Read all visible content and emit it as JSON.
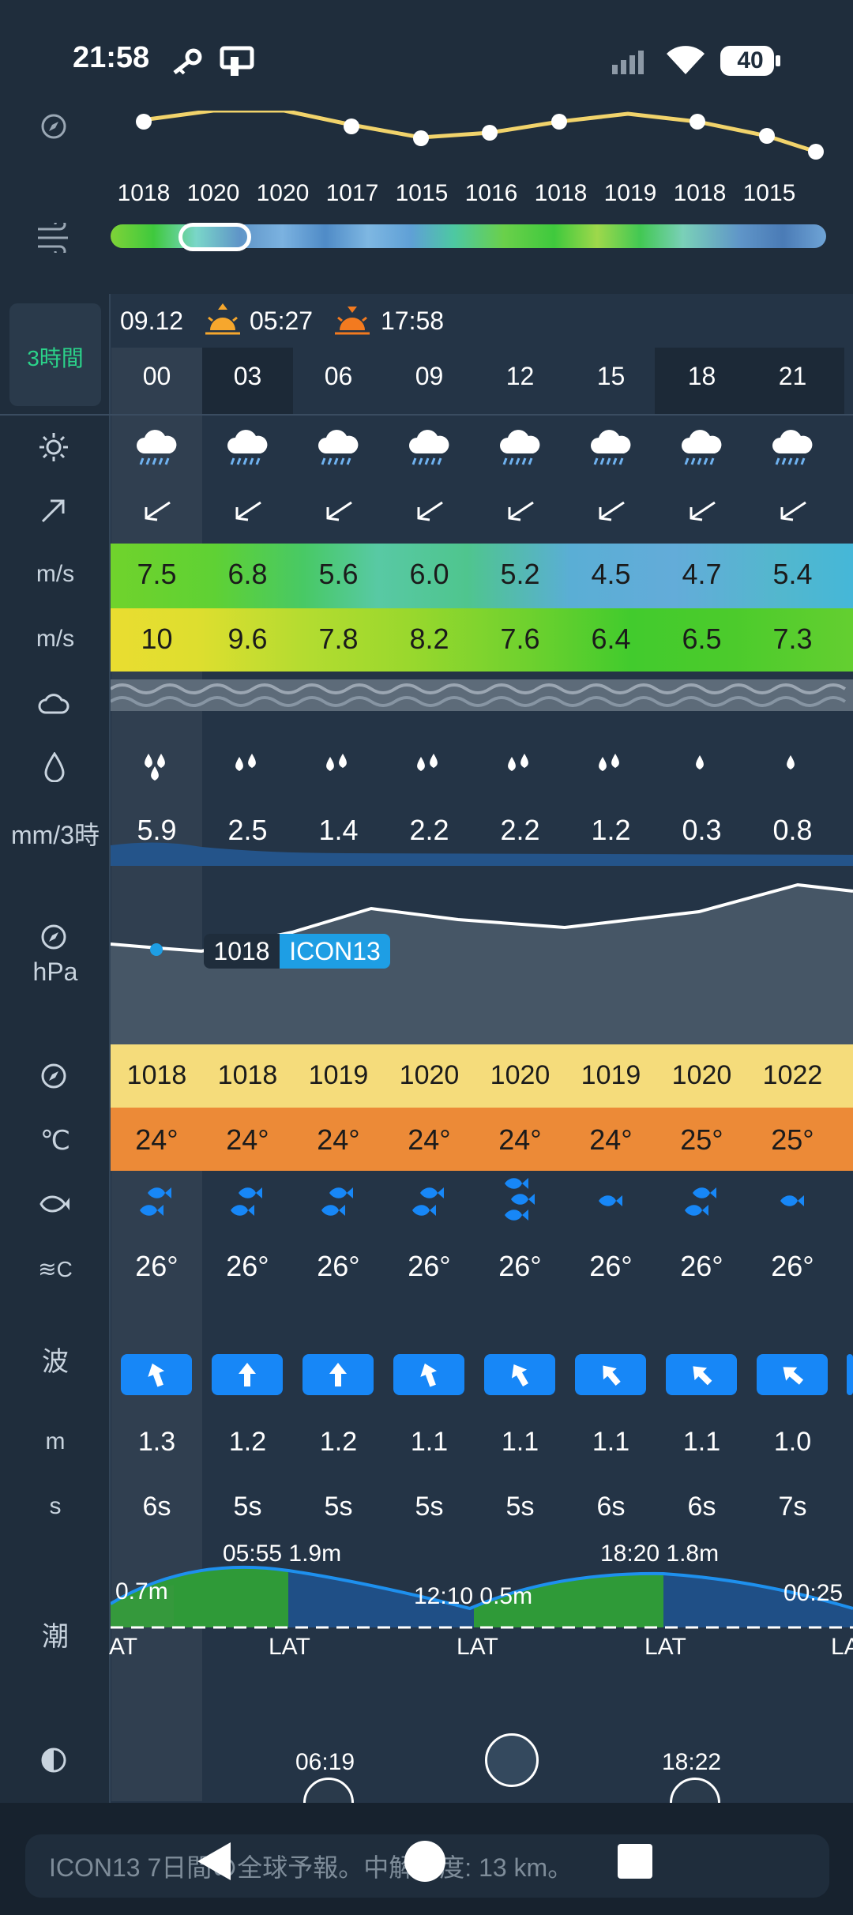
{
  "status_bar": {
    "time": "21:58",
    "battery": "40"
  },
  "top_pressures": [
    "1018",
    "1020",
    "1020",
    "1017",
    "1015",
    "1016",
    "1018",
    "1019",
    "1018",
    "1015"
  ],
  "header": {
    "date": "09.12",
    "sunrise": "05:27",
    "sunset": "17:58",
    "interval_label": "3時間"
  },
  "hours": [
    "00",
    "03",
    "06",
    "09",
    "12",
    "15",
    "18",
    "21"
  ],
  "row_labels": {
    "wind_speed_unit": "m/s",
    "gust_unit": "m/s",
    "precip_unit": "mm/3時",
    "pressure_unit": "hPa",
    "temp_unit": "℃",
    "water_temp_unit": "≋C",
    "wave": "波",
    "wave_height_unit": "m",
    "wave_period_unit": "s",
    "tide": "潮"
  },
  "wind_speed": [
    "7.5",
    "6.8",
    "5.6",
    "6.0",
    "5.2",
    "4.5",
    "4.7",
    "5.4"
  ],
  "gusts": [
    "10",
    "9.6",
    "7.8",
    "8.2",
    "7.6",
    "6.4",
    "6.5",
    "7.3"
  ],
  "precip": [
    "5.9",
    "2.5",
    "1.4",
    "2.2",
    "2.2",
    "1.2",
    "0.3",
    "0.8"
  ],
  "pressure_graph": {
    "current": "1018",
    "model": "ICON13"
  },
  "pressure": [
    "1018",
    "1018",
    "1019",
    "1020",
    "1020",
    "1019",
    "1020",
    "1022"
  ],
  "temperature": [
    "24°",
    "24°",
    "24°",
    "24°",
    "24°",
    "24°",
    "25°",
    "25°"
  ],
  "fish_counts": [
    2,
    2,
    2,
    2,
    3,
    1,
    2,
    1
  ],
  "water_temp": [
    "26°",
    "26°",
    "26°",
    "26°",
    "26°",
    "26°",
    "26°",
    "26°"
  ],
  "wave_height": [
    "1.3",
    "1.2",
    "1.2",
    "1.1",
    "1.1",
    "1.1",
    "1.1",
    "1.0"
  ],
  "wave_period": [
    "6s",
    "5s",
    "5s",
    "5s",
    "5s",
    "6s",
    "6s",
    "7s"
  ],
  "tide": {
    "start": "0.7m",
    "high1": "05:55 1.9m",
    "low1": "12:10 0.5m",
    "high2": "18:20 1.8m",
    "next": "00:25",
    "datum": [
      "AT",
      "LAT",
      "LAT",
      "LAT",
      "LA"
    ]
  },
  "moon": {
    "rise": "06:19",
    "set": "18:22"
  },
  "footer": {
    "model_text": "ICON13 7日間の全球予報。中解像度: 13 km。"
  },
  "colors": {
    "background": "#1f2d3c",
    "accent": "#1787f7",
    "pressure_band": "#f5dc7b",
    "temp_band": "#ec8a37",
    "model_badge": "#1e9ee4"
  }
}
